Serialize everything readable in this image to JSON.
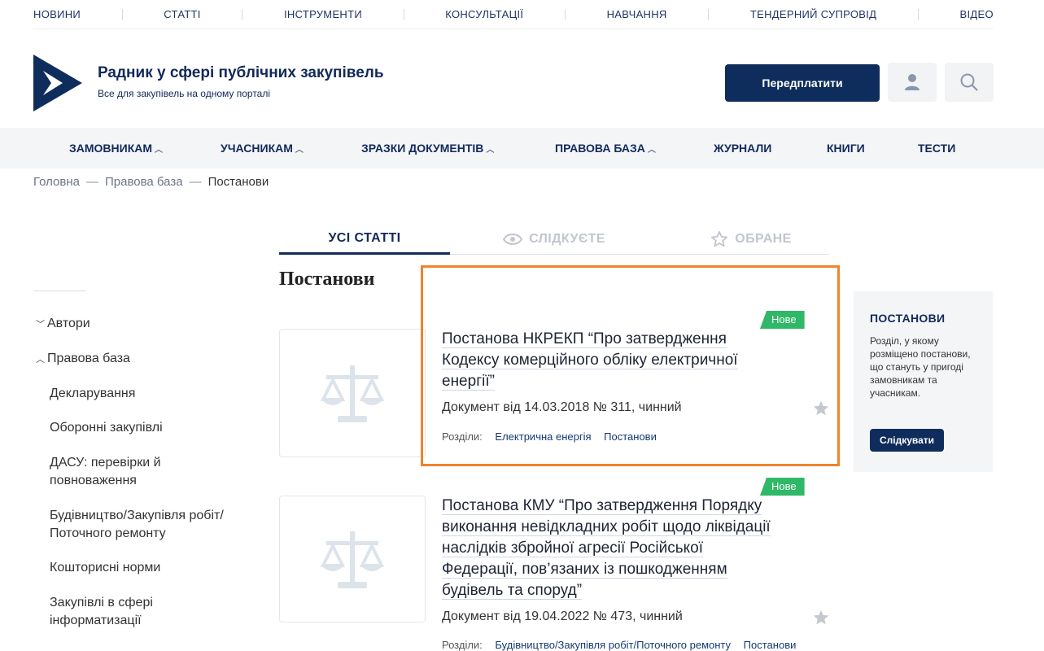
{
  "top_nav": [
    "НОВИНИ",
    "СТАТТІ",
    "ІНСТРУМЕНТИ",
    "КОНСУЛЬТАЦІЇ",
    "НАВЧАННЯ",
    "ТЕНДЕРНИЙ СУПРОВІД",
    "ВІДЕО"
  ],
  "brand": {
    "title": "Радник у сфері публічних закупівель",
    "subtitle": "Все для закупівель на одному порталі"
  },
  "header": {
    "subscribe_label": "Передплатити"
  },
  "main_nav": [
    "ЗАМОВНИКАМ",
    "УЧАСНИКАМ",
    "ЗРАЗКИ ДОКУМЕНТІВ",
    "ПРАВОВА БАЗА",
    "ЖУРНАЛИ",
    "КНИГИ",
    "ТЕСТИ"
  ],
  "breadcrumb": [
    "Головна",
    "Правова база",
    "Постанови"
  ],
  "sidebar": {
    "groups": [
      "Автори",
      "Правова база"
    ],
    "items": [
      "Декларування",
      "Оборонні закупівлі",
      "ДАСУ: перевірки й повноваження",
      "Будівництво/Закупівля робіт/Поточного ремонту",
      "Кошторисні норми",
      "Закупівлі в сфері інформатизації"
    ]
  },
  "tabs": [
    "УСІ СТАТТІ",
    "СЛІДКУЄТЕ",
    "ОБРАНЕ"
  ],
  "section_title": "Постанови",
  "articles": [
    {
      "badge": "Нове",
      "title_lines": [
        "Постанова НКРЕКП “Про затвердження",
        "Кодексу комерційного обліку електричної",
        "енергії”"
      ],
      "meta": "Документ від 14.03.2018  № 311, чинний",
      "sections_label": "Розділи:",
      "tags": [
        "Електрична енергія",
        "Постанови"
      ]
    },
    {
      "badge": "Нове",
      "title_lines": [
        "Постанова КМУ “Про затвердження Порядку",
        "виконання невідкладних робіт щодо ліквідації",
        "наслідків збройної агресії Російської",
        "Федерації, пов’язаних із пошкодженням",
        "будівель та споруд”"
      ],
      "meta": "Документ від 19.04.2022 № 473, чинний",
      "sections_label": "Розділи:",
      "tags": [
        "Будівництво/Закупівля робіт/Поточного ремонту",
        "Постанови"
      ]
    }
  ],
  "info_box": {
    "title": "ПОСТАНОВИ",
    "text": "Розділ, у якому розміщено постанови, що стануть у пригоді замовникам та учасникам.",
    "button_label": "Слідкувати"
  },
  "colors": {
    "brand_navy": "#0f2d5c",
    "badge_green": "#2fb867",
    "highlight_orange": "#f0832c"
  },
  "icons": [
    "logo-icon",
    "user-icon",
    "search-icon",
    "eye-icon",
    "star-icon",
    "scales-icon"
  ]
}
